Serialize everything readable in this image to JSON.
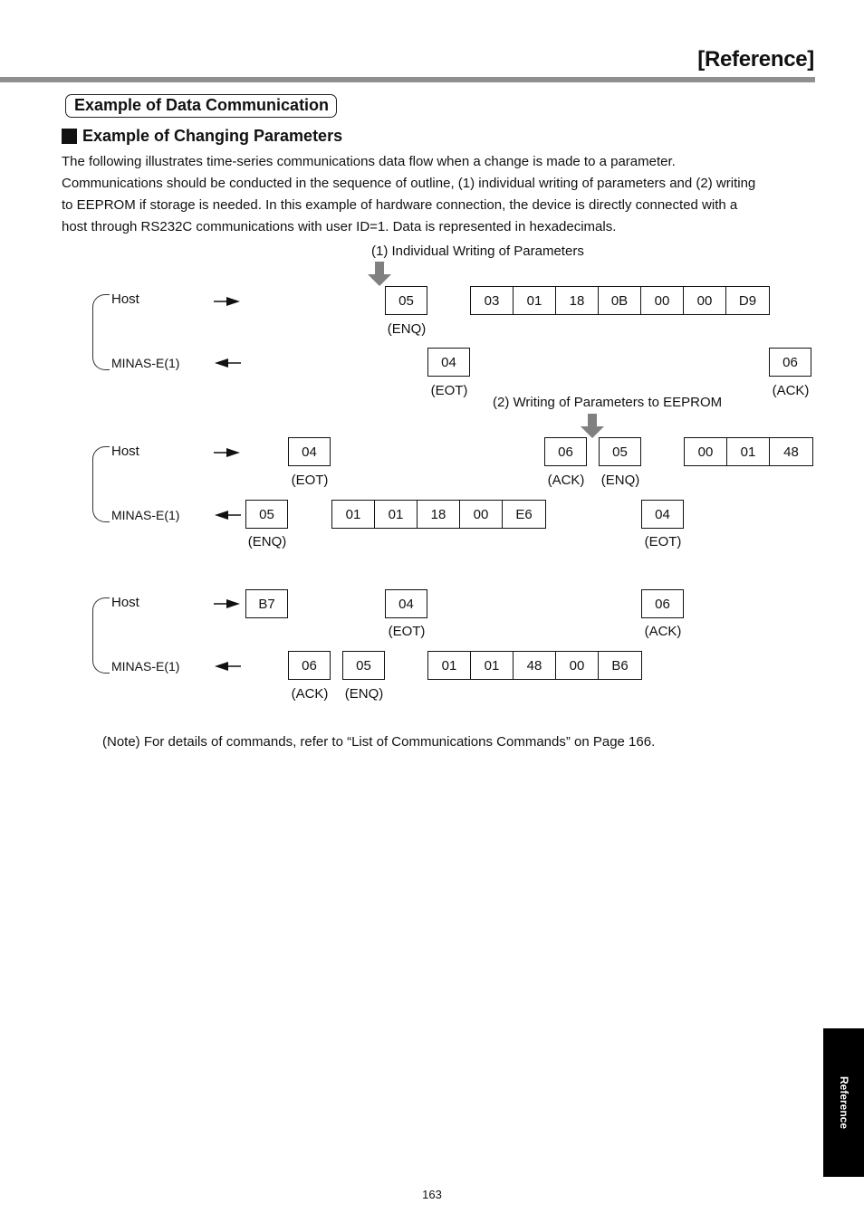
{
  "header": {
    "title": "[Reference]"
  },
  "section_title": "Example of Data Communication",
  "subsection_title": "Example of Changing Parameters",
  "intro_lines": [
    "The following illustrates time-series communications data flow when a change is made to a parameter.",
    "Communications should be conducted in the sequence of outline, (1) individual writing of parameters and (2) writing",
    "to EEPROM if storage is needed.  In this example of hardware connection, the device is directly connected with a",
    "host through RS232C communications with user ID=1.  Data is represented in hexadecimals."
  ],
  "diagram": {
    "host_label": "Host",
    "device_label": "MINAS-E(1)",
    "marker1": "(1) Individual Writing of Parameters",
    "marker2": "(2) Writing of Parameters to EEPROM",
    "block1": {
      "host_enq": {
        "value": "05",
        "caption": "(ENQ)"
      },
      "host_frame": [
        "03",
        "01",
        "18",
        "0B",
        "00",
        "00",
        "D9"
      ],
      "dev_eot": {
        "value": "04",
        "caption": "(EOT)"
      },
      "dev_ack": {
        "value": "06",
        "caption": "(ACK)"
      }
    },
    "block2": {
      "host_eot": {
        "value": "04",
        "caption": "(EOT)"
      },
      "host_ack": {
        "value": "06",
        "caption": "(ACK)"
      },
      "host_enq": {
        "value": "05",
        "caption": "(ENQ)"
      },
      "host_frame": [
        "00",
        "01",
        "48"
      ],
      "dev_enq": {
        "value": "05",
        "caption": "(ENQ)"
      },
      "dev_frame": [
        "01",
        "01",
        "18",
        "00",
        "E6"
      ],
      "dev_eot": {
        "value": "04",
        "caption": "(EOT)"
      }
    },
    "block3": {
      "host_b7": {
        "value": "B7"
      },
      "host_eot": {
        "value": "04",
        "caption": "(EOT)"
      },
      "host_ack": {
        "value": "06",
        "caption": "(ACK)"
      },
      "dev_ack": {
        "value": "06",
        "caption": "(ACK)"
      },
      "dev_enq": {
        "value": "05",
        "caption": "(ENQ)"
      },
      "dev_frame": [
        "01",
        "01",
        "48",
        "00",
        "B6"
      ]
    }
  },
  "note": "(Note) For details of commands, refer to “List of Communications Commands” on Page 166.",
  "side_tab": "Reference",
  "page_number": "163"
}
